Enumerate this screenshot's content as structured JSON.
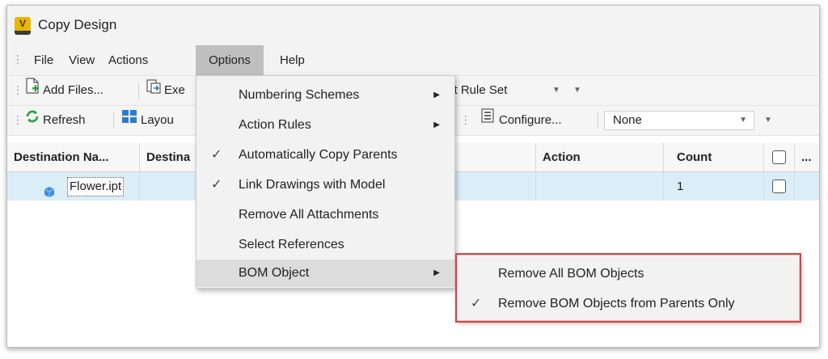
{
  "window": {
    "title": "Copy Design",
    "app_icon": "V"
  },
  "menubar": {
    "items": [
      "File",
      "View",
      "Actions",
      "Options",
      "Help"
    ],
    "active": "Options"
  },
  "toolbar1": {
    "add_files": "Add Files...",
    "exe_partial": "Exe",
    "rule_set_partial": "ılt Rule Set"
  },
  "toolbar2": {
    "refresh": "Refresh",
    "layout_partial": "Layou",
    "configure": "Configure...",
    "filter_value": "None"
  },
  "grid": {
    "headers": [
      "Destination Na...",
      "Destina",
      "Action",
      "Count",
      "..."
    ],
    "rows": [
      {
        "name": "Flower.ipt",
        "count": "1"
      }
    ]
  },
  "options_menu": {
    "items": [
      {
        "label": "Numbering Schemes",
        "submenu": true,
        "checked": false
      },
      {
        "label": "Action Rules",
        "submenu": true,
        "checked": false
      },
      {
        "label": "Automatically Copy Parents",
        "submenu": false,
        "checked": true
      },
      {
        "label": "Link Drawings with Model",
        "submenu": false,
        "checked": true
      },
      {
        "label": "Remove All Attachments",
        "submenu": false,
        "checked": false
      },
      {
        "label": "Select References",
        "submenu": false,
        "checked": false
      },
      {
        "label": "BOM Object",
        "submenu": true,
        "checked": false,
        "highlighted": true
      }
    ]
  },
  "bom_submenu": {
    "items": [
      {
        "label": "Remove All BOM Objects",
        "checked": false
      },
      {
        "label": "Remove BOM Objects from Parents Only",
        "checked": true
      }
    ]
  },
  "colors": {
    "selection_row": "#dbeef8",
    "highlight_border": "#e23d3d",
    "active_menu": "#bfbfbf"
  }
}
